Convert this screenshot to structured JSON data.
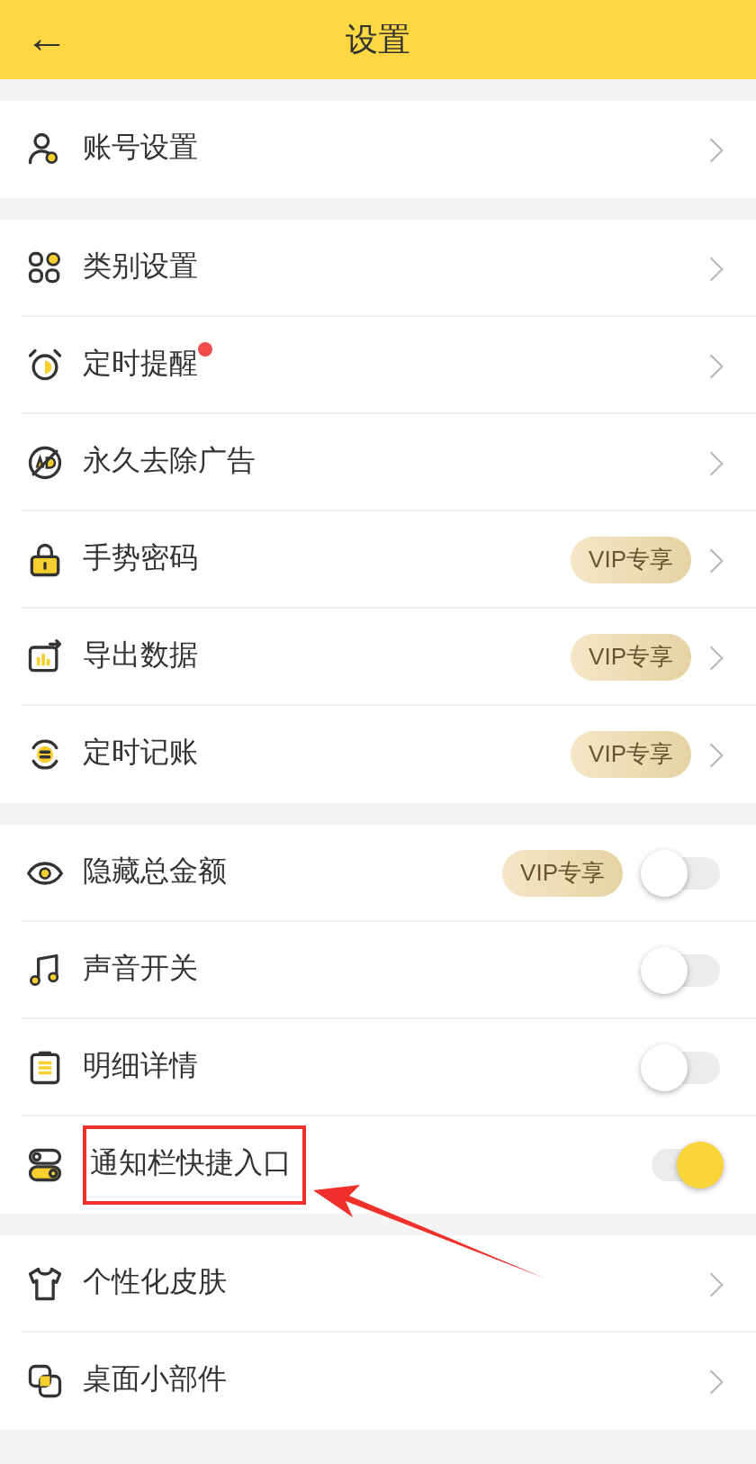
{
  "header": {
    "back": "←",
    "title": "设置"
  },
  "groups": [
    {
      "items": [
        {
          "label": "账号设置",
          "kind": "link",
          "dot": false,
          "highlighted": false
        }
      ]
    },
    {
      "items": [
        {
          "label": "类别设置",
          "kind": "link",
          "dot": false,
          "highlighted": false
        },
        {
          "label": "定时提醒",
          "kind": "link",
          "dot": true,
          "highlighted": false
        },
        {
          "label": "永久去除广告",
          "kind": "link",
          "dot": false,
          "highlighted": false
        },
        {
          "label": "手势密码",
          "kind": "link",
          "vip": "VIP专享",
          "dot": false,
          "highlighted": false
        },
        {
          "label": "导出数据",
          "kind": "link",
          "vip": "VIP专享",
          "dot": false,
          "highlighted": false
        },
        {
          "label": "定时记账",
          "kind": "link",
          "vip": "VIP专享",
          "dot": false,
          "highlighted": false
        }
      ]
    },
    {
      "items": [
        {
          "label": "隐藏总金额",
          "kind": "toggle",
          "vip": "VIP专享",
          "on": false,
          "dot": false,
          "highlighted": false
        },
        {
          "label": "声音开关",
          "kind": "toggle",
          "on": false,
          "dot": false,
          "highlighted": false
        },
        {
          "label": "明细详情",
          "kind": "toggle",
          "on": false,
          "dot": false,
          "highlighted": false
        },
        {
          "label": "通知栏快捷入口",
          "kind": "toggle",
          "on": true,
          "dot": false,
          "highlighted": true
        }
      ]
    },
    {
      "items": [
        {
          "label": "个性化皮肤",
          "kind": "link",
          "dot": false,
          "highlighted": false
        },
        {
          "label": "桌面小部件",
          "kind": "link",
          "dot": false,
          "highlighted": false
        }
      ]
    }
  ]
}
